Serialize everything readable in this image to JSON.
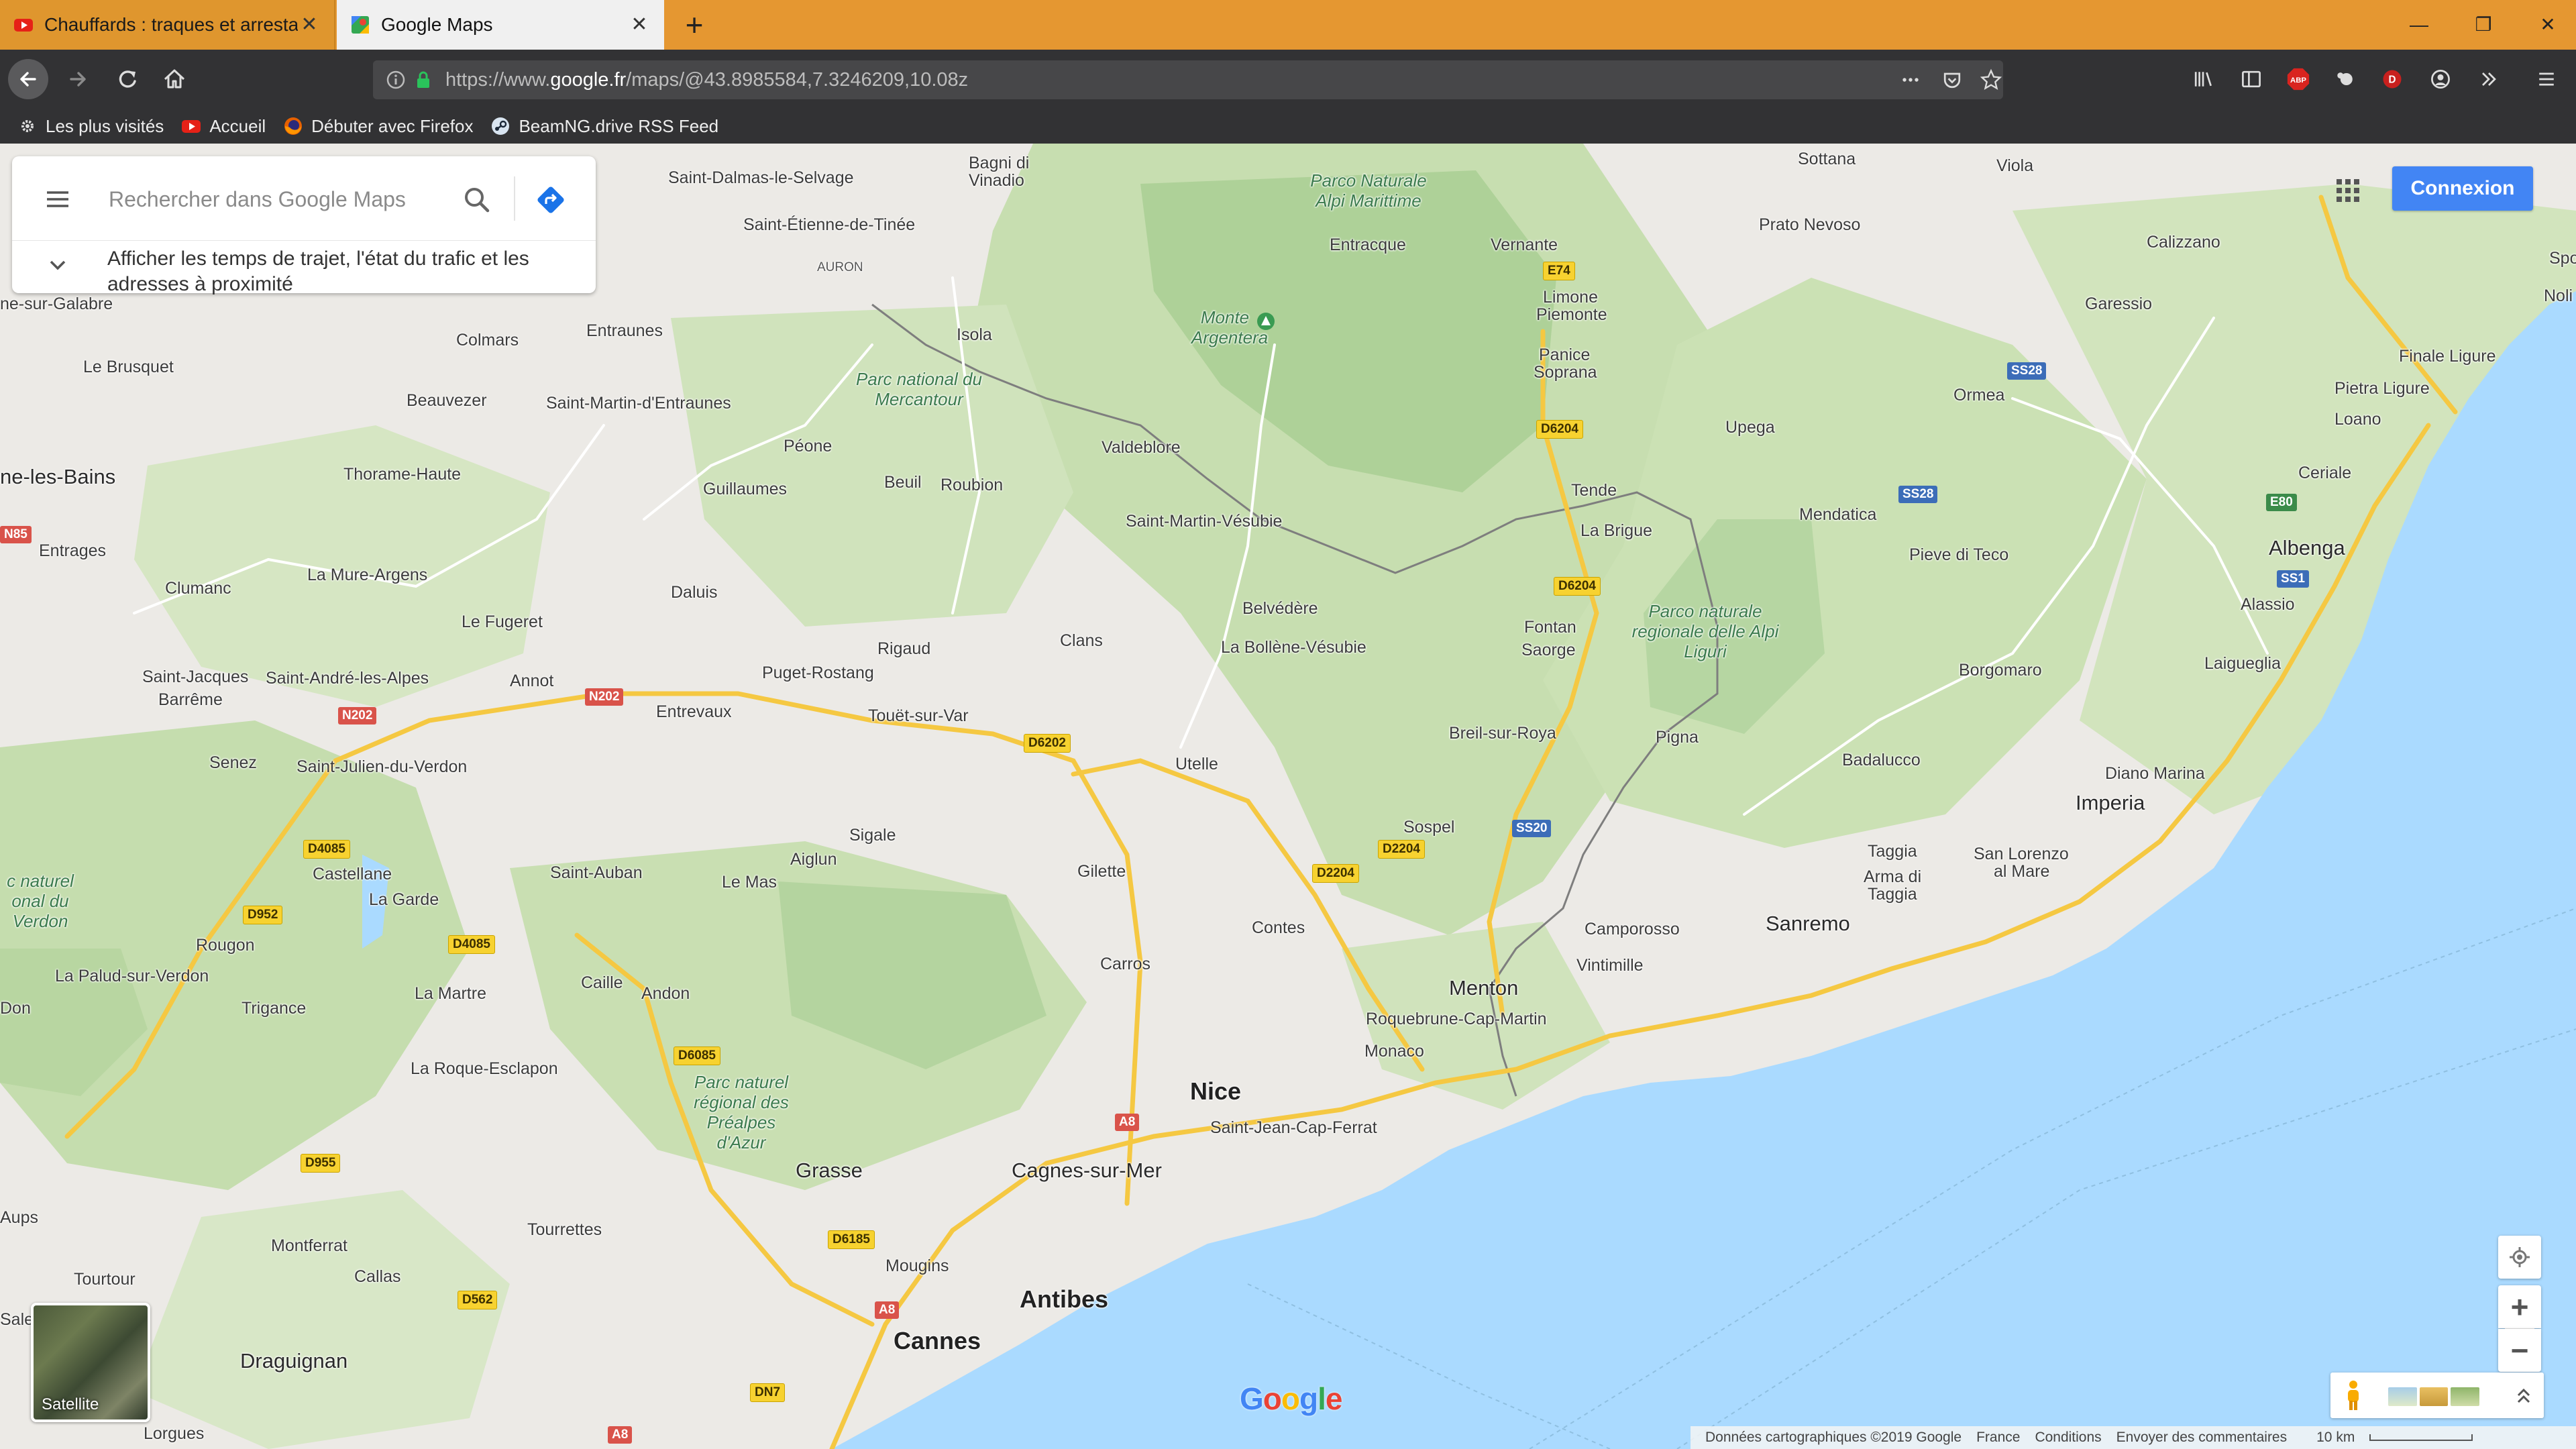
{
  "browser": {
    "tabs": [
      {
        "title": "Chauffards : traques et arrestat",
        "active": false,
        "icon": "youtube-icon"
      },
      {
        "title": "Google Maps",
        "active": true,
        "icon": "google-maps-icon"
      }
    ],
    "url_prefix": "https://www.",
    "url_host": "google.fr",
    "url_path": "/maps/@43.8985584,7.3246209,10.08z",
    "bookmarks": [
      {
        "label": "Les plus visités",
        "icon": "gear-icon"
      },
      {
        "label": "Accueil",
        "icon": "youtube-icon"
      },
      {
        "label": "Débuter avec Firefox",
        "icon": "firefox-icon"
      },
      {
        "label": "BeamNG.drive RSS Feed",
        "icon": "steam-icon"
      }
    ],
    "toolbar_badges": {
      "abp": "ABP",
      "profile": "D"
    }
  },
  "maps": {
    "search_placeholder": "Rechercher dans Google Maps",
    "hint": "Afficher les temps de trajet, l'état du trafic et les adresses à proximité",
    "signin": "Connexion",
    "layer_label": "Satellite",
    "google_logo": "Google",
    "footer": {
      "copyright": "Données cartographiques ©2019 Google",
      "country": "France",
      "terms": "Conditions",
      "feedback": "Envoyer des commentaires",
      "scale": "10 km"
    }
  },
  "map_labels": {
    "cities": [
      "Nice",
      "Cannes",
      "Antibes",
      "Menton",
      "Grasse",
      "Sanremo",
      "Imperia",
      "Albenga",
      "Cagnes-sur-Mer",
      "Draguignan"
    ],
    "towns": [
      "Saint-Dalmas-le-Selvage",
      "Bagni di Vinadio",
      "Vinadio",
      "Entracque",
      "Vernante",
      "Limone Piemonte",
      "Panice Soprana",
      "Sottana",
      "Viola",
      "Prato Nevoso",
      "Calizzano",
      "Garessio",
      "Spotorno",
      "Noli",
      "Finale Ligure",
      "Pietra Ligure",
      "Loano",
      "Ceriale",
      "Alassio",
      "Laigueglia",
      "Diano Marina",
      "San Lorenzo al Mare",
      "Taggia",
      "Arma di Taggia",
      "Badalucco",
      "Borgomaro",
      "Pieve di Teco",
      "Mendatica",
      "Ormea",
      "Upega",
      "Tende",
      "La Brigue",
      "Fontan",
      "Saorge",
      "Breil-sur-Roya",
      "Pigna",
      "Camporosso",
      "Vintimille",
      "Sospel",
      "Roquebrune-Cap-Martin",
      "Monaco",
      "Saint-Jean-Cap-Ferrat",
      "Contes",
      "Carros",
      "Gilette",
      "Utelle",
      "La Bollène-Vésubie",
      "Belvédère",
      "Saint-Martin-Vésubie",
      "Valdeblore",
      "Roubion",
      "Beuil",
      "Péone",
      "Guillaumes",
      "Isola",
      "Saint-Étienne-de-Tinée",
      "Auron",
      "Entraunes",
      "Saint-Martin-d'Entraunes",
      "Colmars",
      "Beauvezer",
      "Thorame-Haute",
      "Le Brusquet",
      "Entrages",
      "Clumanc",
      "La Mure-Argens",
      "Le Fugeret",
      "Daluis",
      "Rigaud",
      "Clans",
      "Puget-Rostang",
      "Touët-sur-Var",
      "Entrevaux",
      "Annot",
      "Saint-André-les-Alpes",
      "Saint-Jacques",
      "Barrême",
      "Senez",
      "Saint-Julien-du-Verdon",
      "Castellane",
      "La Garde",
      "Saint-Auban",
      "Le Mas",
      "Aiglun",
      "Sigale",
      "Rougon",
      "La Palud-sur-Verdon",
      "Trigance",
      "La Martre",
      "Caille",
      "Andon",
      "La Roque-Esclapon",
      "Montferrat",
      "Callas",
      "Tourrettes",
      "Mougins",
      "Tourtour",
      "Lorgues",
      "Digne-les-Bains",
      "Aups",
      "Salernes",
      "Don",
      "sur-Galabre"
    ],
    "parks": [
      "Parco Naturale Alpi Marittime",
      "Parc national du Mercantour",
      "Parco naturale regionale delle Alpi Liguri",
      "Parc naturel régional des Préalpes d'Azur",
      "Parc naturel régional du Verdon"
    ],
    "peaks": [
      "Monte Argentera"
    ],
    "roads": [
      "E74",
      "D6204",
      "SS28",
      "E80",
      "SS1",
      "SS20",
      "D2204",
      "D6202",
      "N202",
      "D4085",
      "D952",
      "D6085",
      "D955",
      "A8",
      "D6185",
      "D562",
      "DN7",
      "N85"
    ]
  }
}
